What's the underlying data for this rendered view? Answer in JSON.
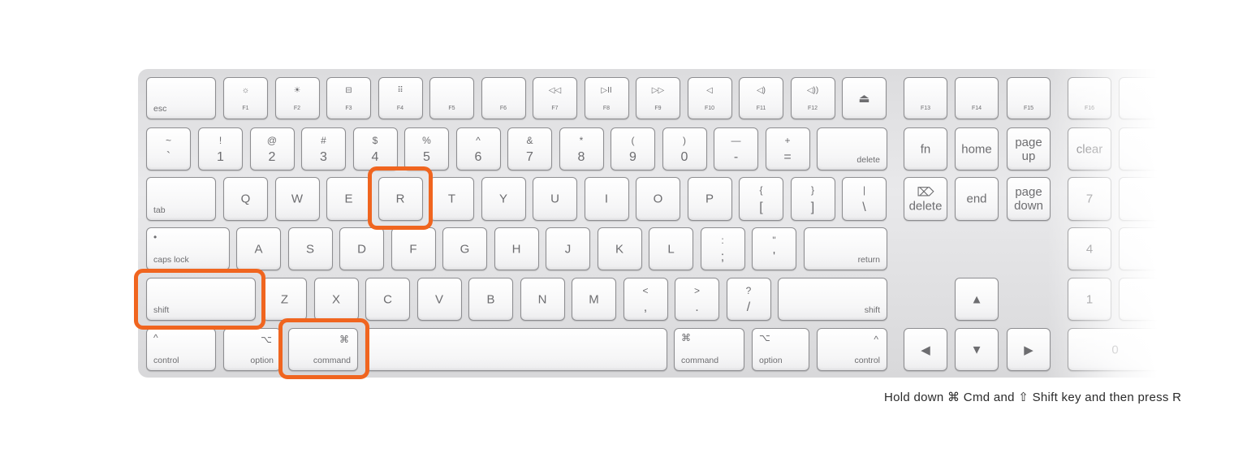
{
  "highlight_color": "#F0651F",
  "caption": "Hold down ⌘ Cmd and ⇧ Shift key and then press R",
  "rows": [
    [
      {
        "bl": "esc"
      },
      {
        "ft": "☼",
        "fb": "F1"
      },
      {
        "ft": "☀",
        "fb": "F2"
      },
      {
        "ft": "⊟",
        "fb": "F3"
      },
      {
        "ft": "⠿",
        "fb": "F4"
      },
      {
        "fb": "F5"
      },
      {
        "fb": "F6"
      },
      {
        "ft": "◁◁",
        "fb": "F7"
      },
      {
        "ft": "▷II",
        "fb": "F8"
      },
      {
        "ft": "▷▷",
        "fb": "F9"
      },
      {
        "ft": "◁",
        "fb": "F10"
      },
      {
        "ft": "◁)",
        "fb": "F11"
      },
      {
        "ft": "◁))",
        "fb": "F12"
      },
      {
        "c": "⏏"
      }
    ],
    [
      {
        "t": "~",
        "b": "`"
      },
      {
        "t": "!",
        "b": "1"
      },
      {
        "t": "@",
        "b": "2"
      },
      {
        "t": "#",
        "b": "3"
      },
      {
        "t": "$",
        "b": "4"
      },
      {
        "t": "%",
        "b": "5"
      },
      {
        "t": "^",
        "b": "6"
      },
      {
        "t": "&",
        "b": "7"
      },
      {
        "t": "*",
        "b": "8"
      },
      {
        "t": "(",
        "b": "9"
      },
      {
        "t": ")",
        "b": "0"
      },
      {
        "t": "—",
        "b": "-"
      },
      {
        "t": "+",
        "b": "="
      },
      {
        "br": "delete"
      }
    ],
    [
      {
        "bl": "tab"
      },
      {
        "c": "Q"
      },
      {
        "c": "W"
      },
      {
        "c": "E"
      },
      {
        "c": "R"
      },
      {
        "c": "T"
      },
      {
        "c": "Y"
      },
      {
        "c": "U"
      },
      {
        "c": "I"
      },
      {
        "c": "O"
      },
      {
        "c": "P"
      },
      {
        "t": "{",
        "b": "["
      },
      {
        "t": "}",
        "b": "]"
      },
      {
        "t": "|",
        "b": "\\"
      }
    ],
    [
      {
        "tl": "•",
        "bl": "caps lock"
      },
      {
        "c": "A"
      },
      {
        "c": "S"
      },
      {
        "c": "D"
      },
      {
        "c": "F"
      },
      {
        "c": "G"
      },
      {
        "c": "H"
      },
      {
        "c": "J"
      },
      {
        "c": "K"
      },
      {
        "c": "L"
      },
      {
        "t": ":",
        "b": ";"
      },
      {
        "t": "\"",
        "b": "'"
      },
      {
        "br": "return"
      }
    ],
    [
      {
        "bl": "shift"
      },
      {
        "c": "Z"
      },
      {
        "c": "X"
      },
      {
        "c": "C"
      },
      {
        "c": "V"
      },
      {
        "c": "B"
      },
      {
        "c": "N"
      },
      {
        "c": "M"
      },
      {
        "t": "<",
        "b": ","
      },
      {
        "t": ">",
        "b": "."
      },
      {
        "t": "?",
        "b": "/"
      },
      {
        "br": "shift"
      }
    ],
    [
      {
        "tl": "^",
        "bl": "control"
      },
      {
        "tr": "⌥",
        "br": "option"
      },
      {
        "tr": "⌘",
        "br": "command"
      },
      {},
      {
        "tl": "⌘",
        "bl": "command"
      },
      {
        "tl": "⌥",
        "bl": "option"
      },
      {
        "tr": "^",
        "br": "control"
      }
    ]
  ],
  "nav": [
    [
      {
        "fb": "F13"
      },
      {
        "fb": "F14"
      },
      {
        "fb": "F15"
      }
    ],
    [
      {
        "c": "fn"
      },
      {
        "c": "home"
      },
      {
        "c": "page up"
      }
    ],
    [
      {
        "c": "⌦ delete"
      },
      {
        "c": "end"
      },
      {
        "c": "page down"
      }
    ],
    [],
    [
      null,
      {
        "c": "▲"
      },
      null
    ],
    [
      {
        "c": "◀"
      },
      {
        "c": "▼"
      },
      {
        "c": "▶"
      }
    ]
  ],
  "numpad": [
    [
      {
        "fb": "F16"
      },
      {},
      {},
      {}
    ],
    [
      {
        "c": "clear"
      },
      {},
      {},
      {}
    ],
    [
      {
        "c": "7"
      },
      {},
      {},
      {}
    ],
    [
      {
        "c": "4"
      },
      {},
      {},
      {}
    ],
    [
      {
        "c": "1"
      },
      {},
      {},
      {}
    ],
    [
      {
        "c": "0"
      },
      {},
      {}
    ]
  ]
}
